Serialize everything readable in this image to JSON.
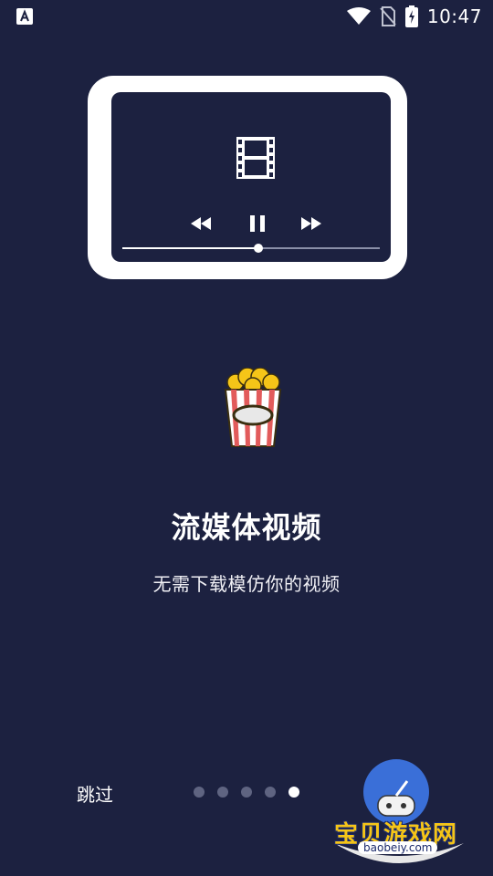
{
  "status_bar": {
    "time": "10:47"
  },
  "player": {
    "progress": 0.53
  },
  "onboarding": {
    "title": "流媒体视频",
    "subtitle": "无需下载模仿你的视频"
  },
  "footer": {
    "skip_label": "跳过",
    "page_count": 5,
    "active_page": 5
  },
  "watermark": {
    "text": "宝贝游戏网",
    "url": "baobeiy.com"
  },
  "colors": {
    "background": "#1c2140",
    "card": "#ffffff",
    "dot_inactive": "#5f6481",
    "dot_active": "#ffffff",
    "popcorn_stripe": "#e25b5b"
  },
  "icons": [
    "app-a-icon",
    "wifi-icon",
    "no-sim-icon",
    "battery-charging-icon",
    "film-icon",
    "rewind-icon",
    "pause-icon",
    "fast-forward-icon",
    "popcorn-icon"
  ]
}
